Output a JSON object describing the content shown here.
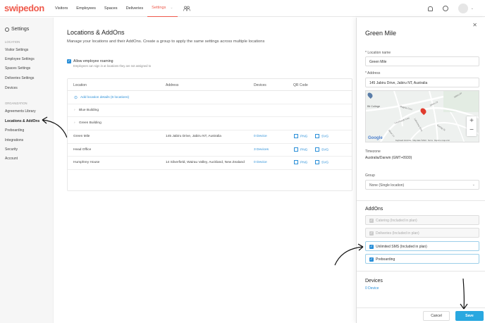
{
  "brand": {
    "logo": "swipedon",
    "accent": "#ef5a4c",
    "link": "#2a8fd8",
    "save_button_color": "#29a8e0"
  },
  "topnav": {
    "items": [
      "Visitors",
      "Employees",
      "Spaces",
      "Deliveries",
      "Settings"
    ],
    "active": "Settings",
    "icons": [
      "people-icon",
      "bell-icon",
      "help-icon",
      "avatar"
    ]
  },
  "sidebar": {
    "title": "Settings",
    "sections": [
      {
        "label": "LOCATION",
        "items": [
          "Visitor Settings",
          "Employee Settings",
          "Spaces Settings",
          "Deliveries Settings",
          "Devices"
        ]
      },
      {
        "label": "ORGANIZATION",
        "items": [
          "Agreements Library",
          "Locations & AddOns",
          "Preboarding",
          "Integrations",
          "Security",
          "Account"
        ]
      }
    ],
    "active_item": "Locations & AddOns"
  },
  "main": {
    "title": "Locations & AddOns",
    "description": "Manage your locations and their AddOns. Create a group to apply the same settings across multiple locations",
    "roaming_label": "Allow employee roaming",
    "roaming_sub": "Employees can sign in at locations they are not assigned to",
    "roaming_checked": true,
    "table": {
      "headers": [
        "Location",
        "Address",
        "Devices",
        "QR Code"
      ],
      "add_link": "Add location details (6 locations)",
      "groups": [
        "Blue Building",
        "Green Building"
      ],
      "rows": [
        {
          "location": "Green Mile",
          "address": "145 Jabiru Drive, Jabiru NT, Australia",
          "devices": "0 Device",
          "png": "PNG",
          "svg": "SVG"
        },
        {
          "location": "Head Office",
          "address": "",
          "devices": "3 Devices",
          "png": "PNG",
          "svg": "SVG"
        },
        {
          "location": "Humphrey House",
          "address": "14 Silverfield, Wairau Valley, Auckland, New Zealand",
          "devices": "0 Device",
          "png": "PNG",
          "svg": "SVG"
        }
      ]
    }
  },
  "panel": {
    "title": "Green Mile",
    "location_name_label": "* Location name",
    "location_name_value": "Green Mile",
    "address_label": "* Address",
    "address_value": "145 Jabiru Drive, Jabiru NT, Australia",
    "map": {
      "labels": [
        "Bil College",
        "Magela Cres",
        "Jabiru Dr",
        "Leichhardt Cres",
        "Lakeview Cres",
        "Silver Ln",
        "Garlag St",
        "Jabiru Dr"
      ],
      "google": "Google",
      "footer": [
        "Keyboard shortcuts",
        "Map data ©2024",
        "Terms",
        "Report a map error"
      ],
      "zoom_in": "+",
      "zoom_out": "−"
    },
    "timezone_label": "Timezone",
    "timezone_value": "Australia/Darwin (GMT+0930)",
    "group_label": "Group",
    "group_value": "None (Single location)",
    "addons_title": "AddOns",
    "addons": [
      {
        "label": "Catering (Included in plan)",
        "enabled": false
      },
      {
        "label": "Deliveries (Included in plan)",
        "enabled": false
      },
      {
        "label": "Unlimited SMS (Included in plan)",
        "enabled": true
      },
      {
        "label": "Preboarding",
        "enabled": true
      }
    ],
    "devices_title": "Devices",
    "devices_link": "0 Device",
    "cancel_label": "Cancel",
    "save_label": "Save",
    "close_symbol": "✕"
  }
}
